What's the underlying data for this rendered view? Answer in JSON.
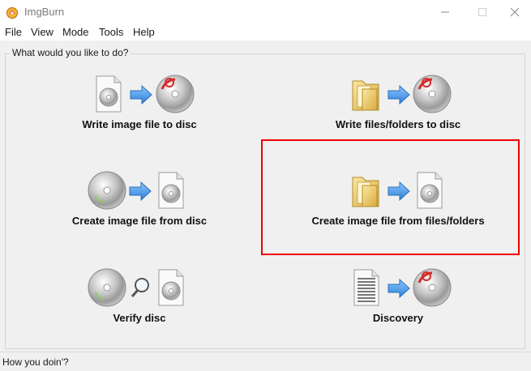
{
  "window": {
    "title": "ImgBurn"
  },
  "menu": [
    "File",
    "View",
    "Mode",
    "Tools",
    "Help"
  ],
  "group_title": "What would you like to do?",
  "actions": {
    "write_image": {
      "label": "Write image file to disc",
      "icons": [
        "image-file-icon",
        "arrow-right-icon",
        "disc-burn-icon"
      ]
    },
    "write_files": {
      "label": "Write files/folders to disc",
      "icons": [
        "folder-icon",
        "arrow-right-icon",
        "disc-burn-icon"
      ]
    },
    "create_from_disc": {
      "label": "Create image file from disc",
      "icons": [
        "disc-icon",
        "arrow-right-icon",
        "image-file-icon"
      ]
    },
    "create_from_files": {
      "label": "Create image file from files/folders",
      "icons": [
        "folder-icon",
        "arrow-right-icon",
        "image-file-icon"
      ]
    },
    "verify": {
      "label": "Verify disc",
      "icons": [
        "disc-icon",
        "magnifier-icon",
        "image-file-icon"
      ]
    },
    "discovery": {
      "label": "Discovery",
      "icons": [
        "data-file-icon",
        "arrow-right-icon",
        "disc-burn-icon"
      ]
    }
  },
  "status": "How you doin'?",
  "colors": {
    "highlight": "#ee0000",
    "arrow": "#3b8fe0",
    "burn": "#d62b2b",
    "folder": "#e6c35c"
  }
}
